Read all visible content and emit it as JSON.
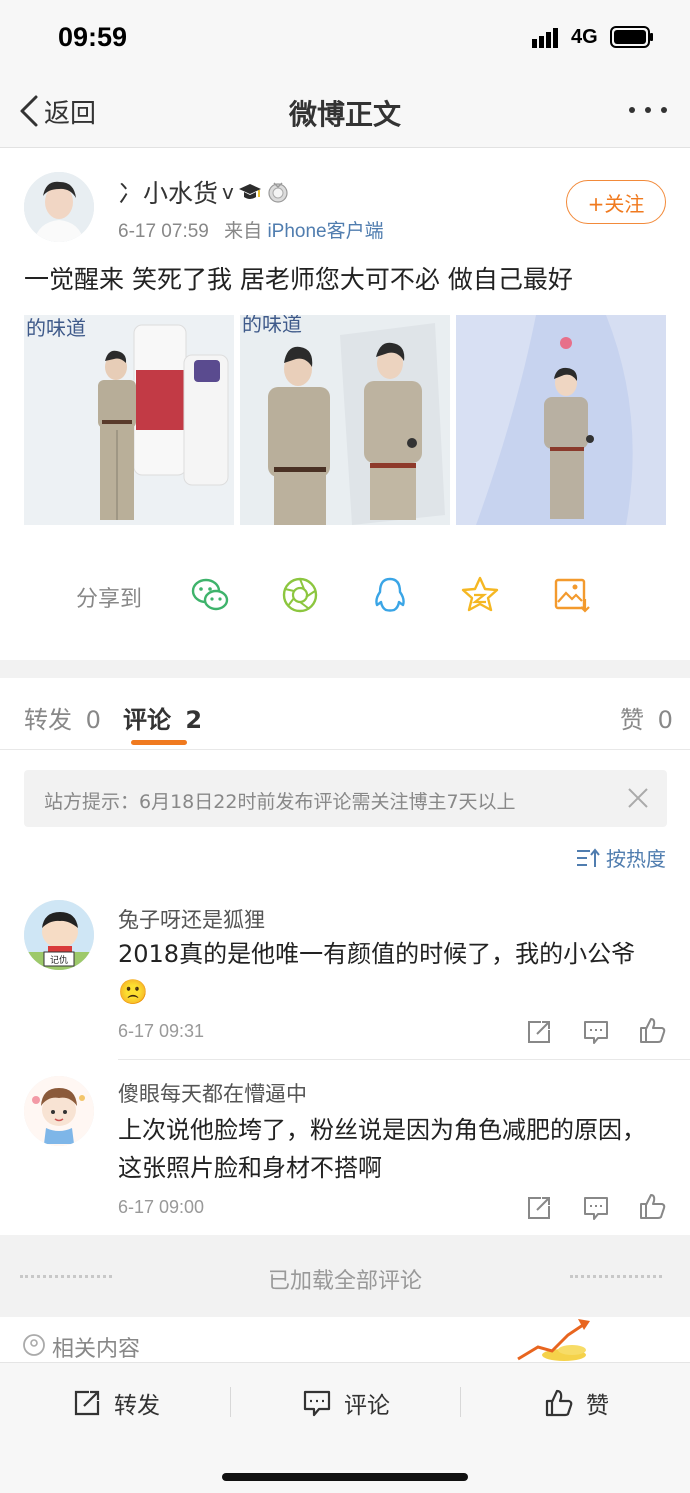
{
  "status": {
    "time": "09:59",
    "network": "4G"
  },
  "nav": {
    "back_label": "返回",
    "title": "微博正文"
  },
  "post": {
    "username": "冫小水货",
    "verified_mark": "v",
    "timestamp": "6-17 07:59",
    "source_prefix": "来自",
    "source": "iPhone客户端",
    "follow_label": "+关注",
    "text": "一觉醒来 笑死了我 居老师您大可不必 做自己最好",
    "photo_captions": [
      "的味道",
      "的味道"
    ]
  },
  "share": {
    "label": "分享到",
    "targets": [
      "wechat-icon",
      "moments-icon",
      "qq-icon",
      "qzone-icon",
      "save-image-icon"
    ]
  },
  "tabs": [
    {
      "label": "转发",
      "count": "0"
    },
    {
      "label": "评论",
      "count": "2"
    },
    {
      "label": "赞",
      "count": "0"
    }
  ],
  "notice": {
    "text": "站方提示：6月18日22时前发布评论需关注博主7天以上"
  },
  "sort_label": "按热度",
  "comments": [
    {
      "name": "兔子呀还是狐狸",
      "text": "2018真的是他唯一有颜值的时候了，我的小公爷",
      "emoji": "🙁",
      "time": "6-17 09:31",
      "avatar_tag": "记仇"
    },
    {
      "name": "傻眼每天都在懵逼中",
      "text": "上次说他脸垮了，粉丝说是因为角色减肥的原因，这张照片脸和身材不搭啊",
      "time": "6-17 09:00"
    }
  ],
  "loaded_text": "已加载全部评论",
  "related_label": "相关内容",
  "bottom": {
    "repost_label": "转发",
    "comment_label": "评论",
    "like_label": "赞"
  },
  "colors": {
    "accent": "#f07a1f",
    "link": "#507daf"
  }
}
